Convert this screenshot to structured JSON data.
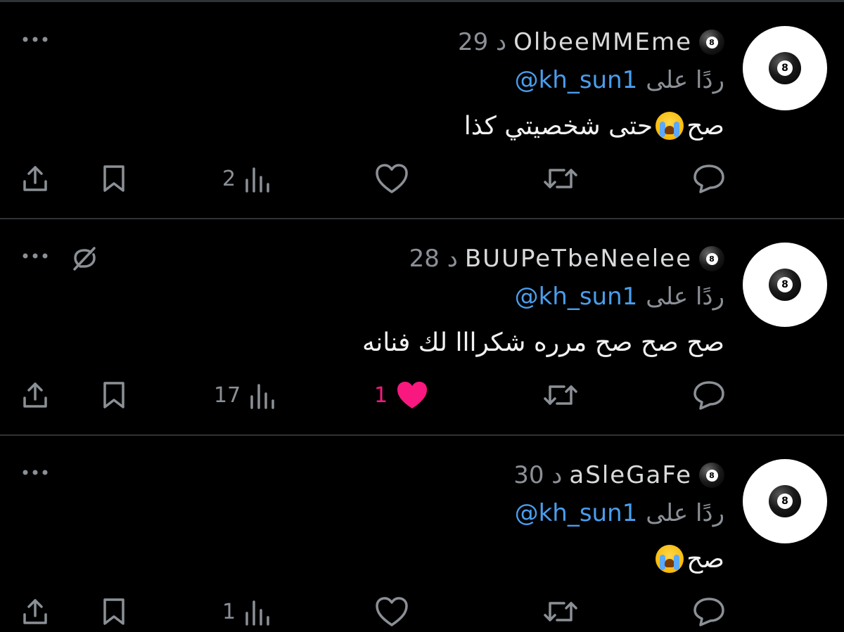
{
  "tweets": [
    {
      "author_name": "OlbeeMMEme",
      "time": "29 د",
      "reply_prefix": "ردًا على",
      "reply_handle": "@kh_sun1",
      "text_before_emoji": "صح",
      "emoji": "loudly-crying-face",
      "text_after_emoji": "حتى شخصيتي كذا",
      "views": "2",
      "likes": "",
      "liked": false,
      "muted": false
    },
    {
      "author_name": "BUUPeTbeNeelee",
      "time": "28 د",
      "reply_prefix": "ردًا على",
      "reply_handle": "@kh_sun1",
      "text_before_emoji": "",
      "emoji": "",
      "text_after_emoji": "صح صح صح مرره شكرااا لك فنانه",
      "views": "17",
      "likes": "1",
      "liked": true,
      "muted": true
    },
    {
      "author_name": "aSleGaFe",
      "time": "30 د",
      "reply_prefix": "ردًا على",
      "reply_handle": "@kh_sun1",
      "text_before_emoji": "صح",
      "emoji": "loudly-crying-face",
      "text_after_emoji": "",
      "views": "1",
      "likes": "",
      "liked": false,
      "muted": false
    }
  ],
  "colors": {
    "background": "#000000",
    "divider": "#2f3336",
    "muted_text": "#8b9096",
    "handle_blue": "#4a9ded",
    "like_pink": "#f91880"
  },
  "icons": [
    "more-icon",
    "mute-icon",
    "share-icon",
    "bookmark-icon",
    "views-icon",
    "like-icon",
    "retweet-icon",
    "reply-icon",
    "eight-ball-avatar"
  ]
}
